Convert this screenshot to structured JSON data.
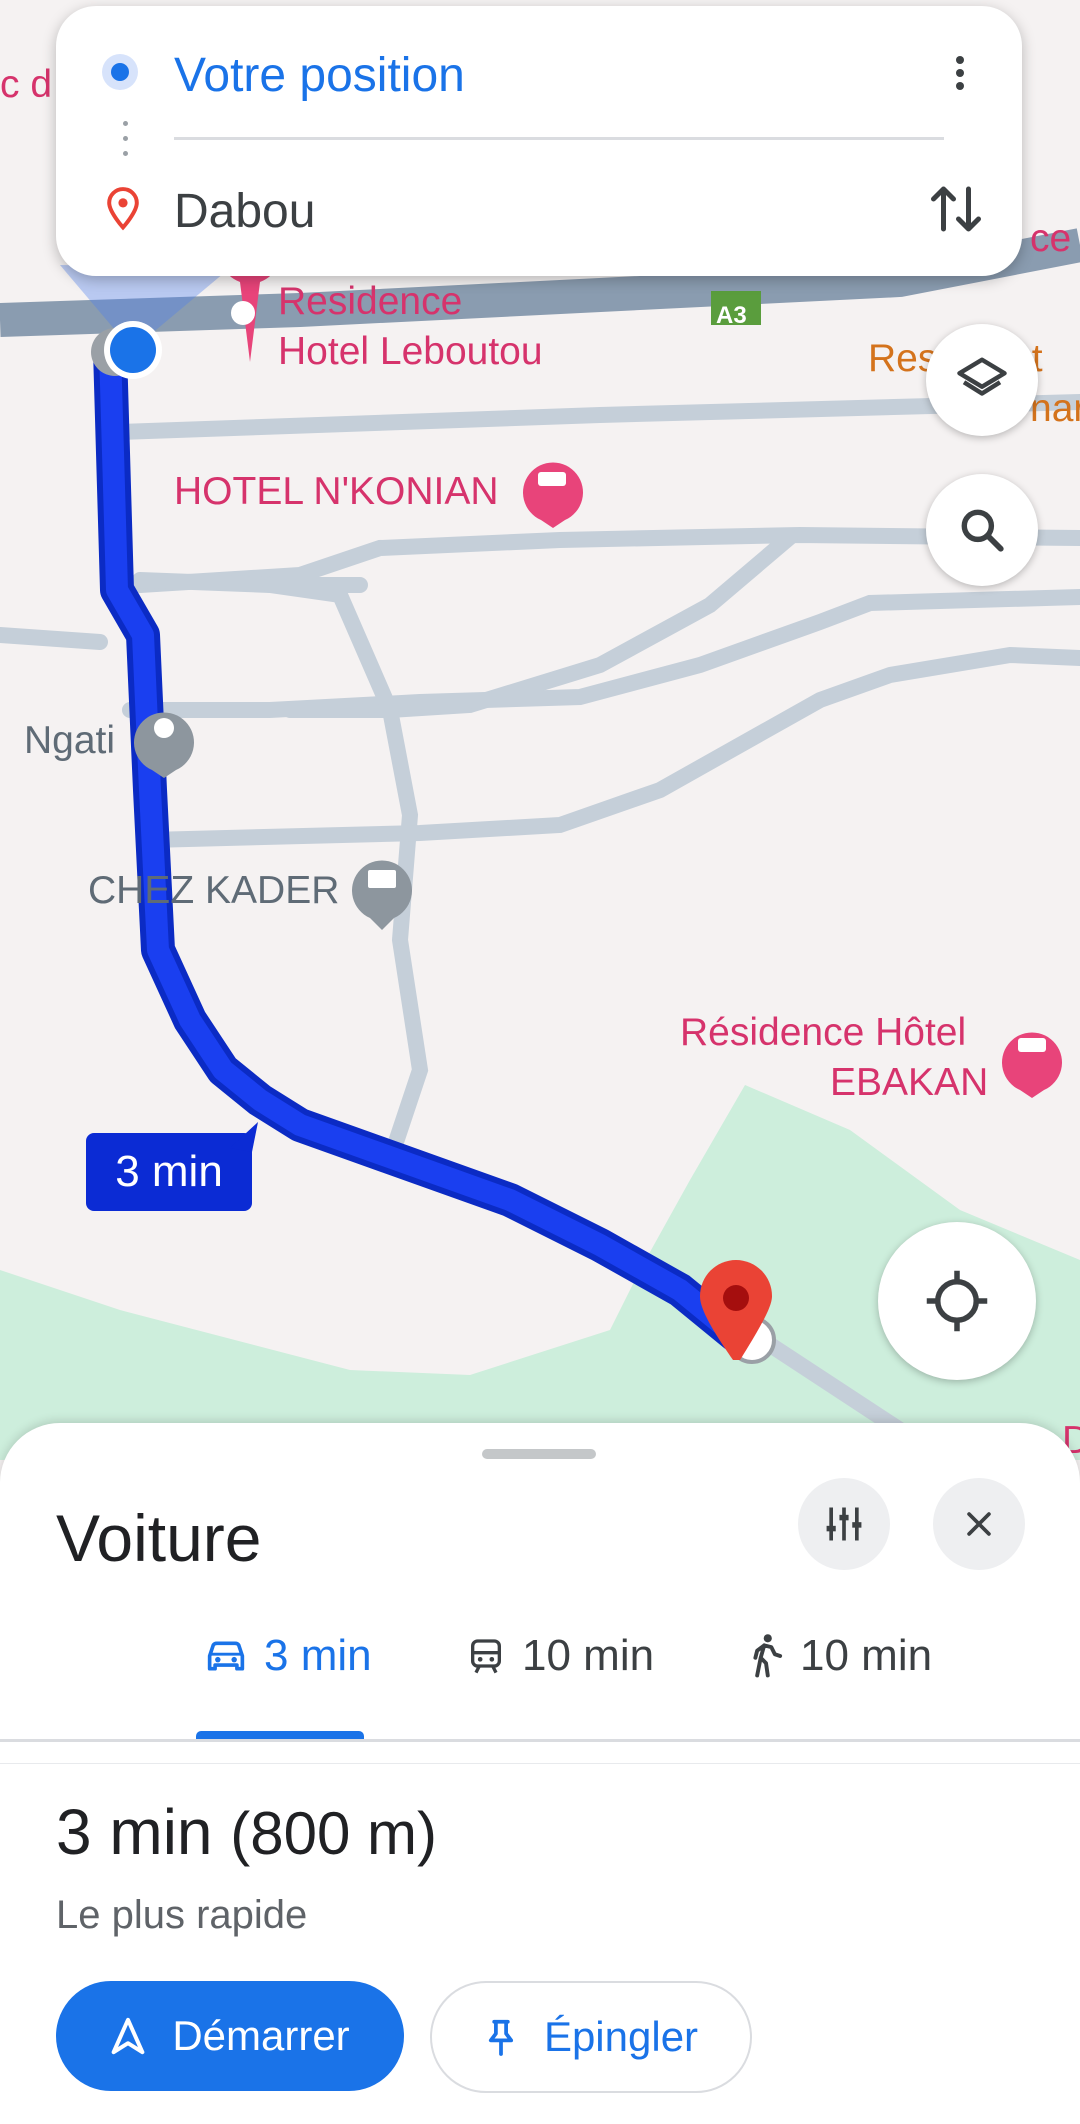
{
  "route_card": {
    "origin": "Votre position",
    "destination": "Dabou"
  },
  "map": {
    "labels": {
      "residence_hotel_leboutou_1": "Residence",
      "residence_hotel_leboutou_2": "Hotel Leboutou",
      "hotel_nkonian": "HOTEL N'KONIAN",
      "ngati": "Ngati",
      "chez_kader": "CHEZ KADER",
      "residence_hotel_ebakan_1": "Résidence Hôtel",
      "residence_hotel_ebakan_2": "EBAKAN",
      "road_a3": "A3",
      "edge_left": "c d",
      "edge_right_top": "ce",
      "edge_right_1": "Res",
      "edge_right_2": "nt",
      "edge_right_3": "nar",
      "edge_right_bottom": "D"
    },
    "eta_bubble": "3 min",
    "colors": {
      "route": "#1a3ff0",
      "route_outline": "#0b2bc4",
      "road": "#c5cfd9",
      "highway": "#8a9cb0",
      "park": "#cdeedc",
      "poi_pink": "#e8447a",
      "destination_pin": "#ea4335"
    }
  },
  "bottom_sheet": {
    "title": "Voiture",
    "modes": [
      {
        "icon": "car-icon",
        "label": "3 min",
        "selected": true
      },
      {
        "icon": "train-icon",
        "label": "10 min",
        "selected": false
      },
      {
        "icon": "walking-icon",
        "label": "10 min",
        "selected": false
      }
    ],
    "summary": {
      "time": "3 min",
      "distance": "(800 m)",
      "subtitle": "Le plus rapide"
    },
    "start_label": "Démarrer",
    "pin_label": "Épingler"
  }
}
